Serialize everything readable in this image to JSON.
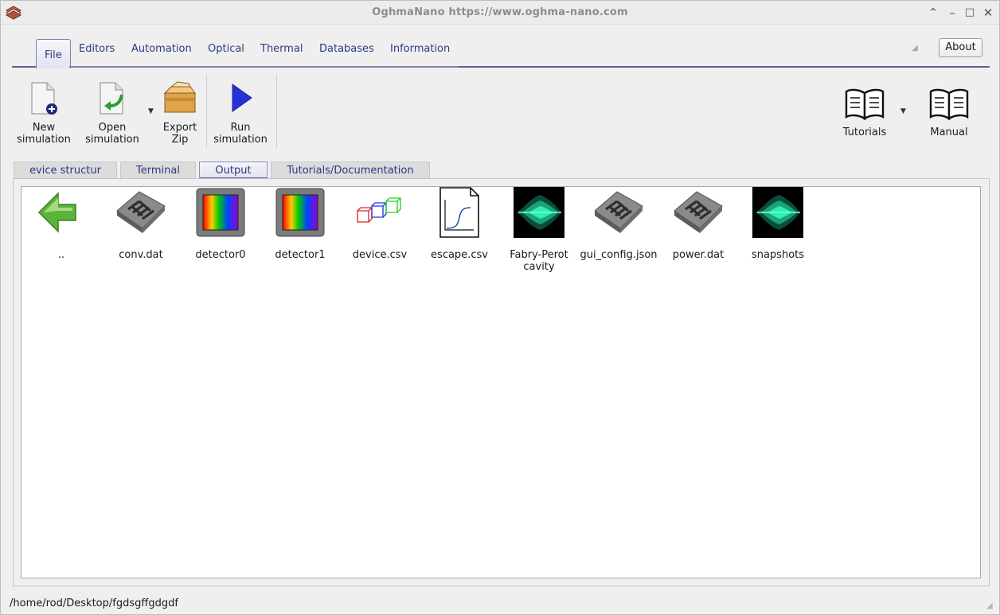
{
  "window": {
    "title": "OghmaNano https://www.oghma-nano.com",
    "controls": [
      "chevron-up-icon",
      "minimize-icon",
      "maximize-icon",
      "close-icon"
    ]
  },
  "ribbon": {
    "tabs": [
      {
        "label": "File",
        "active": true
      },
      {
        "label": "Editors"
      },
      {
        "label": "Automation"
      },
      {
        "label": "Optical"
      },
      {
        "label": "Thermal"
      },
      {
        "label": "Databases"
      },
      {
        "label": "Information"
      }
    ],
    "about_label": "About",
    "tools": {
      "new_simulation": {
        "line1": "New",
        "line2": "simulation",
        "icon": "new-document-icon"
      },
      "open_simulation": {
        "line1": "Open",
        "line2": "simulation",
        "icon": "open-document-icon"
      },
      "export_zip": {
        "line1": "Export",
        "line2": "Zip",
        "icon": "box-icon"
      },
      "run_simulation": {
        "line1": "Run",
        "line2": "simulation",
        "icon": "play-icon"
      },
      "tutorials": {
        "label": "Tutorials",
        "icon": "book-icon"
      },
      "manual": {
        "label": "Manual",
        "icon": "book-icon"
      }
    }
  },
  "doc_tabs": [
    {
      "label": "evice structur"
    },
    {
      "label": "Terminal"
    },
    {
      "label": "Output",
      "active": true
    },
    {
      "label": "Tutorials/Documentation"
    }
  ],
  "files": [
    {
      "name": "..",
      "icon": "back-arrow-icon"
    },
    {
      "name": "conv.dat",
      "icon": "data-file-icon"
    },
    {
      "name": "detector0",
      "icon": "detector-icon"
    },
    {
      "name": "detector1",
      "icon": "detector-icon"
    },
    {
      "name": "device.csv",
      "icon": "cubes-icon"
    },
    {
      "name": "escape.csv",
      "icon": "graph-file-icon"
    },
    {
      "name_line1": "Fabry-Perot",
      "name_line2": "cavity",
      "icon": "cavity-icon"
    },
    {
      "name": "gui_config.json",
      "icon": "data-file-icon"
    },
    {
      "name": "power.dat",
      "icon": "data-file-icon"
    },
    {
      "name": "snapshots",
      "icon": "cavity-icon"
    }
  ],
  "status": {
    "path": "/home/rod/Desktop/fgdsgffgdgdf"
  },
  "colors": {
    "accent": "#5a5e9c",
    "tab_text": "#2b3a86",
    "run_blue": "#2433d8",
    "arrow_green": "#5db33a"
  }
}
